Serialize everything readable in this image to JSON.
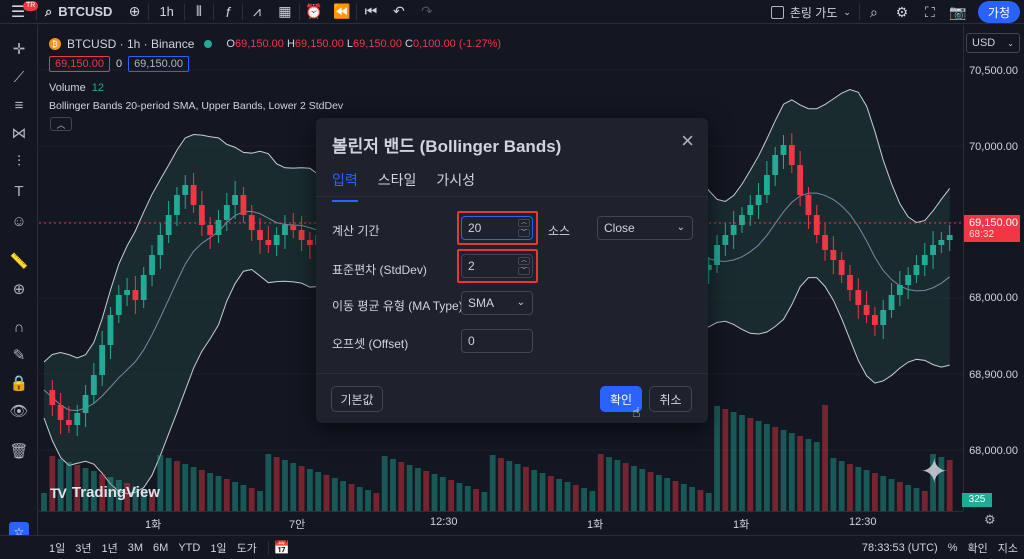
{
  "topbar": {
    "notif_badge": "TR",
    "symbol": "BTCUSD",
    "interval": "1h",
    "layout_label": "촌링 가도",
    "publish_label": "가청"
  },
  "legend": {
    "title": "BTCUSD · 1h · Binance",
    "ohlc": [
      {
        "k": "O",
        "v": "69,150.00"
      },
      {
        "k": "H",
        "v": "69,150.00"
      },
      {
        "k": "L",
        "v": "69,150.00"
      },
      {
        "k": "C",
        "v": "0,100.00 (-1.27%)"
      }
    ],
    "sell_price": "69,150.00",
    "spread": "0",
    "buy_price": "69,150.00",
    "volume_label": "Volume",
    "volume_value": "12",
    "bb_label": "Bollinger Bands 20-period SMA, Upper Bands, Lower 2 StdDev"
  },
  "price_axis": {
    "currency": "USD",
    "labels": [
      "70,500.00",
      "70,000.00",
      "68,000.00",
      "68,900.00",
      "68,000.00"
    ],
    "last_price": "69,150.00",
    "countdown": "68:32",
    "volume_tag": "325"
  },
  "time_axis": [
    "1화",
    "7안",
    "12:30",
    "1화",
    "1화",
    "12:30"
  ],
  "watermark": "TradingView",
  "bottombar": {
    "ranges": [
      "1일",
      "3년",
      "1년",
      "3M",
      "6M",
      "YTD",
      "1일",
      "도가"
    ],
    "clock": "78:33:53 (UTC)",
    "percent": "%",
    "confirm": "확인",
    "auto": "지소"
  },
  "dialog": {
    "title": "볼린저 밴드 (Bollinger Bands)",
    "tabs": [
      "입력",
      "스타일",
      "가시성"
    ],
    "length_label": "계산 기간",
    "length_value": "20",
    "source_label": "소스",
    "source_value": "Close",
    "stddev_label": "표준편차 (StdDev)",
    "stddev_value": "2",
    "ma_type_label": "이동 평균 유형 (MA Type)",
    "ma_type_value": "SMA",
    "offset_label": "오프셋 (Offset)",
    "offset_value": "0",
    "defaults_button": "기본값",
    "ok_button": "확인",
    "cancel_button": "취소"
  },
  "chart_data": {
    "type": "candlestick",
    "colors": {
      "up": "#22ab94",
      "down": "#f23645",
      "band_fill": "#1f3d3a"
    },
    "ylim": [
      67800,
      70700
    ]
  }
}
